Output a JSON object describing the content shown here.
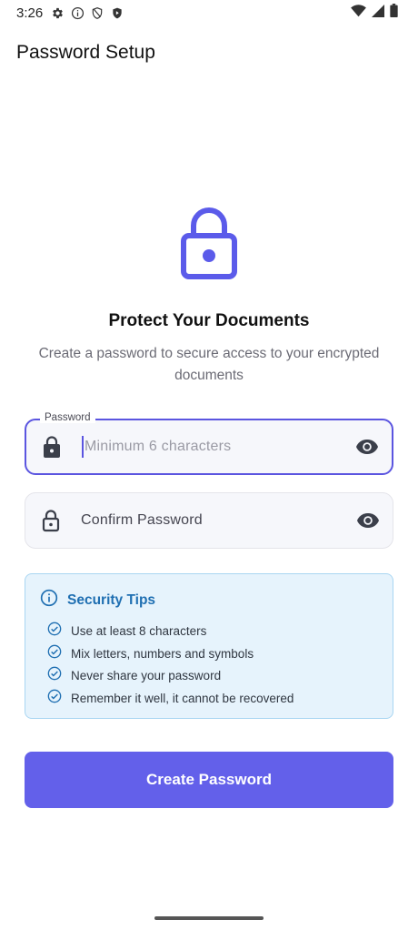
{
  "status_bar": {
    "time": "3:26",
    "left_icons": [
      "gear-icon",
      "info-icon",
      "shield-icon",
      "play-shield-icon"
    ],
    "right_icons": [
      "wifi-icon",
      "signal-icon",
      "battery-icon"
    ]
  },
  "app_bar": {
    "title": "Password Setup"
  },
  "hero": {
    "icon": "lock-icon",
    "title": "Protect Your Documents",
    "subtitle": "Create a password to secure access to your encrypted documents"
  },
  "password_field": {
    "label": "Password",
    "placeholder": "Minimum 6 characters",
    "value": ""
  },
  "confirm_field": {
    "label": "Confirm Password",
    "value": ""
  },
  "tips": {
    "title": "Security Tips",
    "items": [
      "Use at least 8 characters",
      "Mix letters, numbers and symbols",
      "Never share your password",
      "Remember it well, it cannot be recovered"
    ]
  },
  "create_button": {
    "label": "Create Password"
  },
  "colors": {
    "accent": "#6360ea",
    "tips_bg": "#e6f3fc",
    "tips_title": "#1f6fb2"
  }
}
